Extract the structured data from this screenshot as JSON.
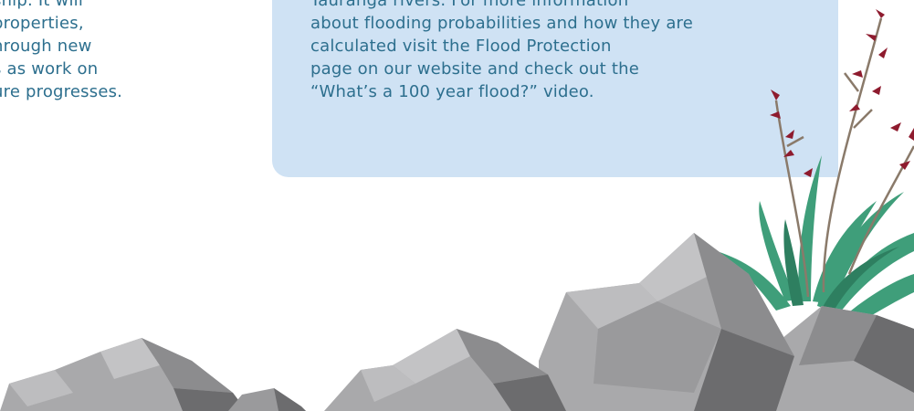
{
  "left_paragraph": {
    "lines": [
      "ship. It will",
      "properties,",
      "hrough new",
      "s as work on",
      "ure progresses."
    ]
  },
  "info_box": {
    "lines": [
      "Tauranga rivers. For more information",
      "about flooding probabilities and how they are",
      "calculated visit the Flood Protection",
      "page on our website and check out the",
      "“What’s a 100 year flood?” video."
    ]
  },
  "colors": {
    "text": "#2d6f8e",
    "box": "#cfe2f4",
    "rock_light": "#a9a9ab",
    "rock_mid": "#8c8c8e",
    "rock_dark": "#6c6c6e",
    "leaf": "#3f9e7a",
    "flower": "#8e1b2e",
    "stem": "#8a7a6a"
  }
}
